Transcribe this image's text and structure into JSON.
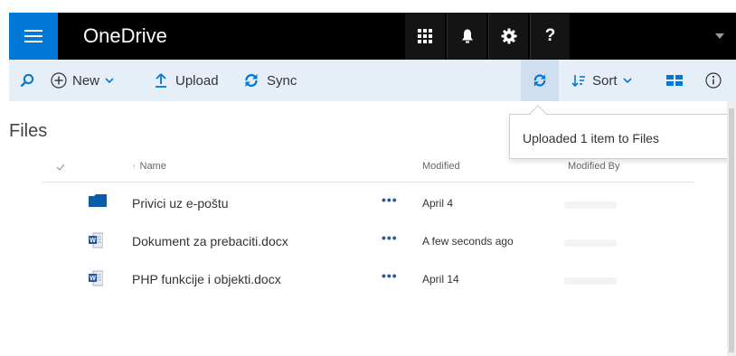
{
  "header": {
    "app_title": "OneDrive",
    "menu_icon": "hamburger-icon",
    "app_launcher_icon": "app-launcher-icon",
    "notifications_icon": "bell-icon",
    "settings_icon": "gear-icon",
    "help_label": "?",
    "colors": {
      "brand": "#0078d7",
      "bar": "#000000"
    }
  },
  "commands": {
    "search_icon": "search-icon",
    "new_label": "New",
    "upload_label": "Upload",
    "sync_label": "Sync",
    "sort_label": "Sort",
    "refresh_icon": "refresh-icon",
    "view_icon": "tiles-view-icon",
    "info_icon": "info-icon",
    "colors": {
      "bar": "#e6eef8",
      "icon": "#0078d7"
    }
  },
  "main": {
    "title": "Files",
    "columns": {
      "name": "Name",
      "modified": "Modified",
      "modified_by": "Modified By"
    },
    "rows": [
      {
        "icon": "folder-icon",
        "name": "Privici uz e-poštu",
        "more": "•••",
        "modified": "April 4"
      },
      {
        "icon": "word-doc-icon",
        "name": "Dokument za prebaciti.docx",
        "more": "•••",
        "modified": "A few seconds ago"
      },
      {
        "icon": "word-doc-icon",
        "name": "PHP funkcije i objekti.docx",
        "more": "•••",
        "modified": "April 14"
      }
    ]
  },
  "notification": {
    "text": "Uploaded 1 item to Files"
  }
}
